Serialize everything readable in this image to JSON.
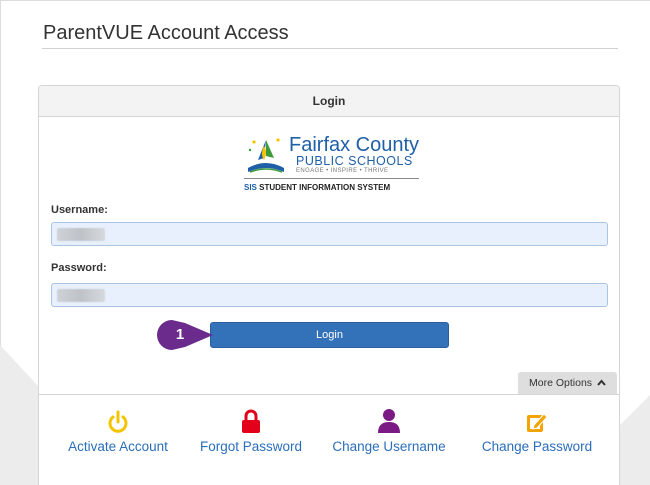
{
  "page": {
    "title": "ParentVUE Account Access"
  },
  "panel": {
    "header": "Login"
  },
  "logo": {
    "line1": "Fairfax County",
    "line2": "PUBLIC SCHOOLS",
    "line3": "ENGAGE • INSPIRE • THRIVE",
    "sis": "SIS",
    "line4": "STUDENT INFORMATION SYSTEM"
  },
  "form": {
    "username_label": "Username:",
    "password_label": "Password:",
    "login_label": "Login"
  },
  "callout": {
    "step": "1"
  },
  "more_options": {
    "label": "More Options"
  },
  "options": [
    {
      "label": "Activate Account",
      "icon": "power-icon",
      "color": "#f5c400"
    },
    {
      "label": "Forgot Password",
      "icon": "lock-icon",
      "color": "#e3001b"
    },
    {
      "label": "Change Username",
      "icon": "user-icon",
      "color": "#7b1a84"
    },
    {
      "label": "Change Password",
      "icon": "edit-icon",
      "color": "#f4a300"
    }
  ],
  "colors": {
    "accent": "#3371b8",
    "link": "#2a6ebb",
    "callout": "#6b2b8c"
  }
}
